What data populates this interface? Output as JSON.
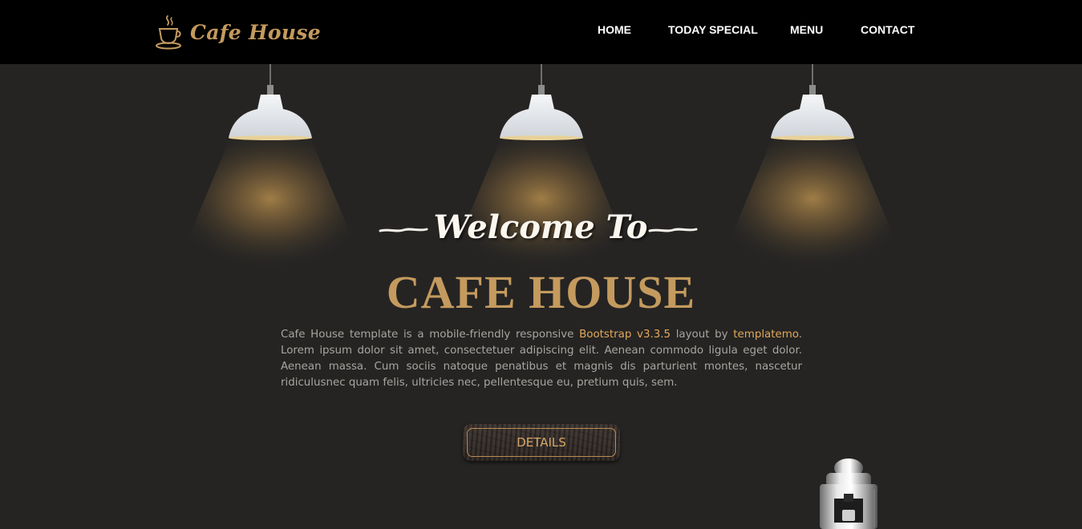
{
  "brand": {
    "name": "Cafe House",
    "icon": "coffee-cup-icon"
  },
  "nav": {
    "items": [
      {
        "label": "HOME"
      },
      {
        "label": "TODAY SPECIAL"
      },
      {
        "label": "MENU"
      },
      {
        "label": "CONTACT"
      }
    ]
  },
  "hero": {
    "welcome": "Welcome To",
    "title": "CAFE HOUSE",
    "desc_part1": "Cafe House template is a mobile-friendly responsive ",
    "desc_link1": "Bootstrap v3.3.5",
    "desc_part2": " layout by ",
    "desc_link2": "templatemo",
    "desc_part3": ". Lorem ipsum dolor sit amet, consectetuer adipiscing elit. Aenean commodo ligula eget dolor. Aenean massa. Cum sociis natoque penatibus et magnis dis parturient montes, nascetur ridiculusnec quam felis, ultricies nec, pellentesque eu, pretium quis, sem.",
    "button_label": "DETAILS"
  },
  "colors": {
    "background": "#252423",
    "navbar": "#000000",
    "accent_gold": "#c49a5e",
    "link": "#e2a85a",
    "body_text": "#a9a5a0"
  }
}
